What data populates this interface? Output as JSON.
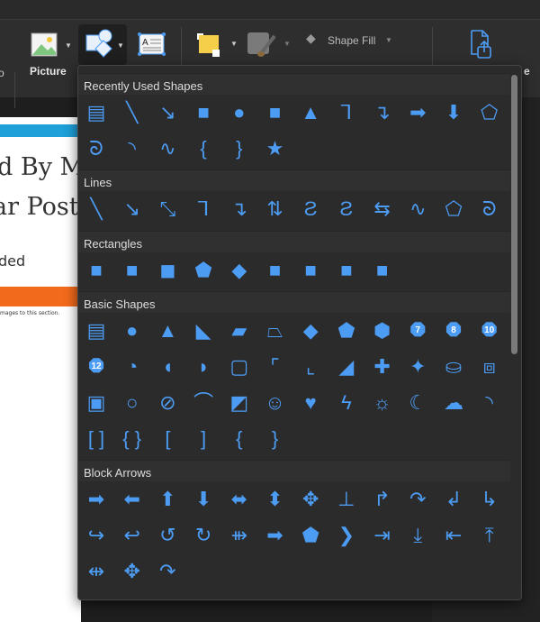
{
  "ribbon": {
    "picture_label": "Picture",
    "shape_fill_label": "Shape Fill",
    "share_partial": "e",
    "left_partial": "o"
  },
  "document": {
    "line1": "d By Ma",
    "line2": "ar Poster",
    "line3": "ded",
    "note": "mages to this section."
  },
  "colors": {
    "shape": "#4d9cf4",
    "menu_bg": "#2b2b2b"
  },
  "menu": {
    "sections": [
      {
        "title": "Recently Used Shapes",
        "rows": [
          [
            "text-box",
            "line",
            "arrow-line",
            "rectangle",
            "oval",
            "rounded-rectangle",
            "triangle",
            "elbow-connector",
            "elbow-arrow-connector",
            "right-arrow",
            "down-arrow",
            "freeform"
          ],
          [
            "scribble",
            "arc",
            "curve",
            "left-brace",
            "right-brace",
            "star"
          ]
        ]
      },
      {
        "title": "Lines",
        "rows": [
          [
            "line",
            "arrow-line",
            "double-arrow-line",
            "elbow-connector",
            "elbow-arrow-connector",
            "elbow-double-arrow-connector",
            "curved-connector",
            "curved-arrow-connector",
            "curved-double-arrow-connector",
            "curve",
            "freeform",
            "scribble"
          ]
        ]
      },
      {
        "title": "Rectangles",
        "rows": [
          [
            "rectangle",
            "rounded-rectangle",
            "snip-single-corner",
            "snip-same-side",
            "snip-diagonal",
            "snip-round",
            "round-single-corner",
            "round-same-side",
            "round-diagonal"
          ]
        ]
      },
      {
        "title": "Basic Shapes",
        "rows": [
          [
            "text-box",
            "oval",
            "triangle",
            "right-triangle",
            "parallelogram",
            "trapezoid",
            "diamond",
            "pentagon",
            "hexagon",
            {
              "n": "heptagon",
              "label": "7"
            },
            {
              "n": "octagon",
              "label": "8"
            },
            {
              "n": "decagon",
              "label": "10"
            }
          ],
          [
            {
              "n": "dodecagon",
              "label": "12"
            },
            "pie",
            "chord",
            "teardrop",
            "frame",
            "half-frame",
            "l-shape",
            "diagonal-stripe",
            "cross",
            "plaque",
            "can",
            "cube"
          ],
          [
            "bevel",
            "donut",
            "no-symbol",
            "block-arc",
            "folded-corner",
            "smiley-face",
            "heart",
            "lightning-bolt",
            "sun",
            "moon",
            "cloud",
            "arc"
          ],
          [
            "double-bracket",
            "double-brace",
            "left-bracket",
            "right-bracket",
            "left-brace",
            "right-brace"
          ]
        ]
      },
      {
        "title": "Block Arrows",
        "rows": [
          [
            "right-arrow",
            "left-arrow",
            "up-arrow",
            "down-arrow",
            "left-right-arrow",
            "up-down-arrow",
            "quad-arrow",
            "left-right-up-arrow",
            "bent-arrow",
            "u-turn-arrow",
            "left-up-arrow",
            "bent-up-arrow"
          ],
          [
            "curved-right-arrow",
            "curved-left-arrow",
            "curved-up-arrow",
            "curved-down-arrow",
            "striped-right-arrow",
            "notched-right-arrow",
            "pentagon-arrow",
            "chevron",
            "right-arrow-callout",
            "down-arrow-callout",
            "left-arrow-callout",
            "up-arrow-callout"
          ],
          [
            "left-right-arrow-callout",
            "quad-arrow-callout",
            "circular-arrow"
          ]
        ]
      }
    ]
  }
}
